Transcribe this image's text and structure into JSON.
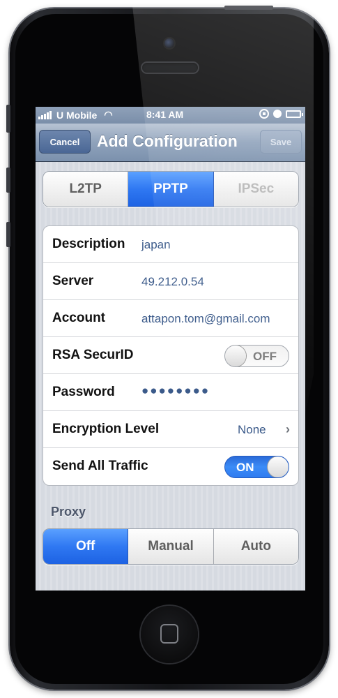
{
  "status_bar": {
    "carrier": "U Mobile",
    "time": "8:41 AM"
  },
  "nav": {
    "cancel_label": "Cancel",
    "title": "Add Configuration",
    "save_label": "Save"
  },
  "vpn_types": [
    {
      "label": "L2TP",
      "selected": false
    },
    {
      "label": "PPTP",
      "selected": true
    },
    {
      "label": "IPSec",
      "selected": false
    }
  ],
  "fields": {
    "description": {
      "label": "Description",
      "value": "japan"
    },
    "server": {
      "label": "Server",
      "value": "49.212.0.54"
    },
    "account": {
      "label": "Account",
      "value": "attapon.tom@gmail.com"
    },
    "rsa": {
      "label": "RSA SecurID",
      "toggle": "OFF"
    },
    "password": {
      "label": "Password",
      "value": "●●●●●●●●"
    },
    "encryption": {
      "label": "Encryption Level",
      "value": "None"
    },
    "send_all": {
      "label": "Send All Traffic",
      "toggle": "ON"
    }
  },
  "proxy": {
    "header": "Proxy",
    "options": [
      {
        "label": "Off",
        "selected": true
      },
      {
        "label": "Manual",
        "selected": false
      },
      {
        "label": "Auto",
        "selected": false
      }
    ]
  },
  "icons": [
    "signal-icon",
    "wifi-icon",
    "rotation-lock-icon",
    "alarm-clock-icon",
    "battery-icon",
    "chevron-right-icon",
    "home-button-icon"
  ]
}
